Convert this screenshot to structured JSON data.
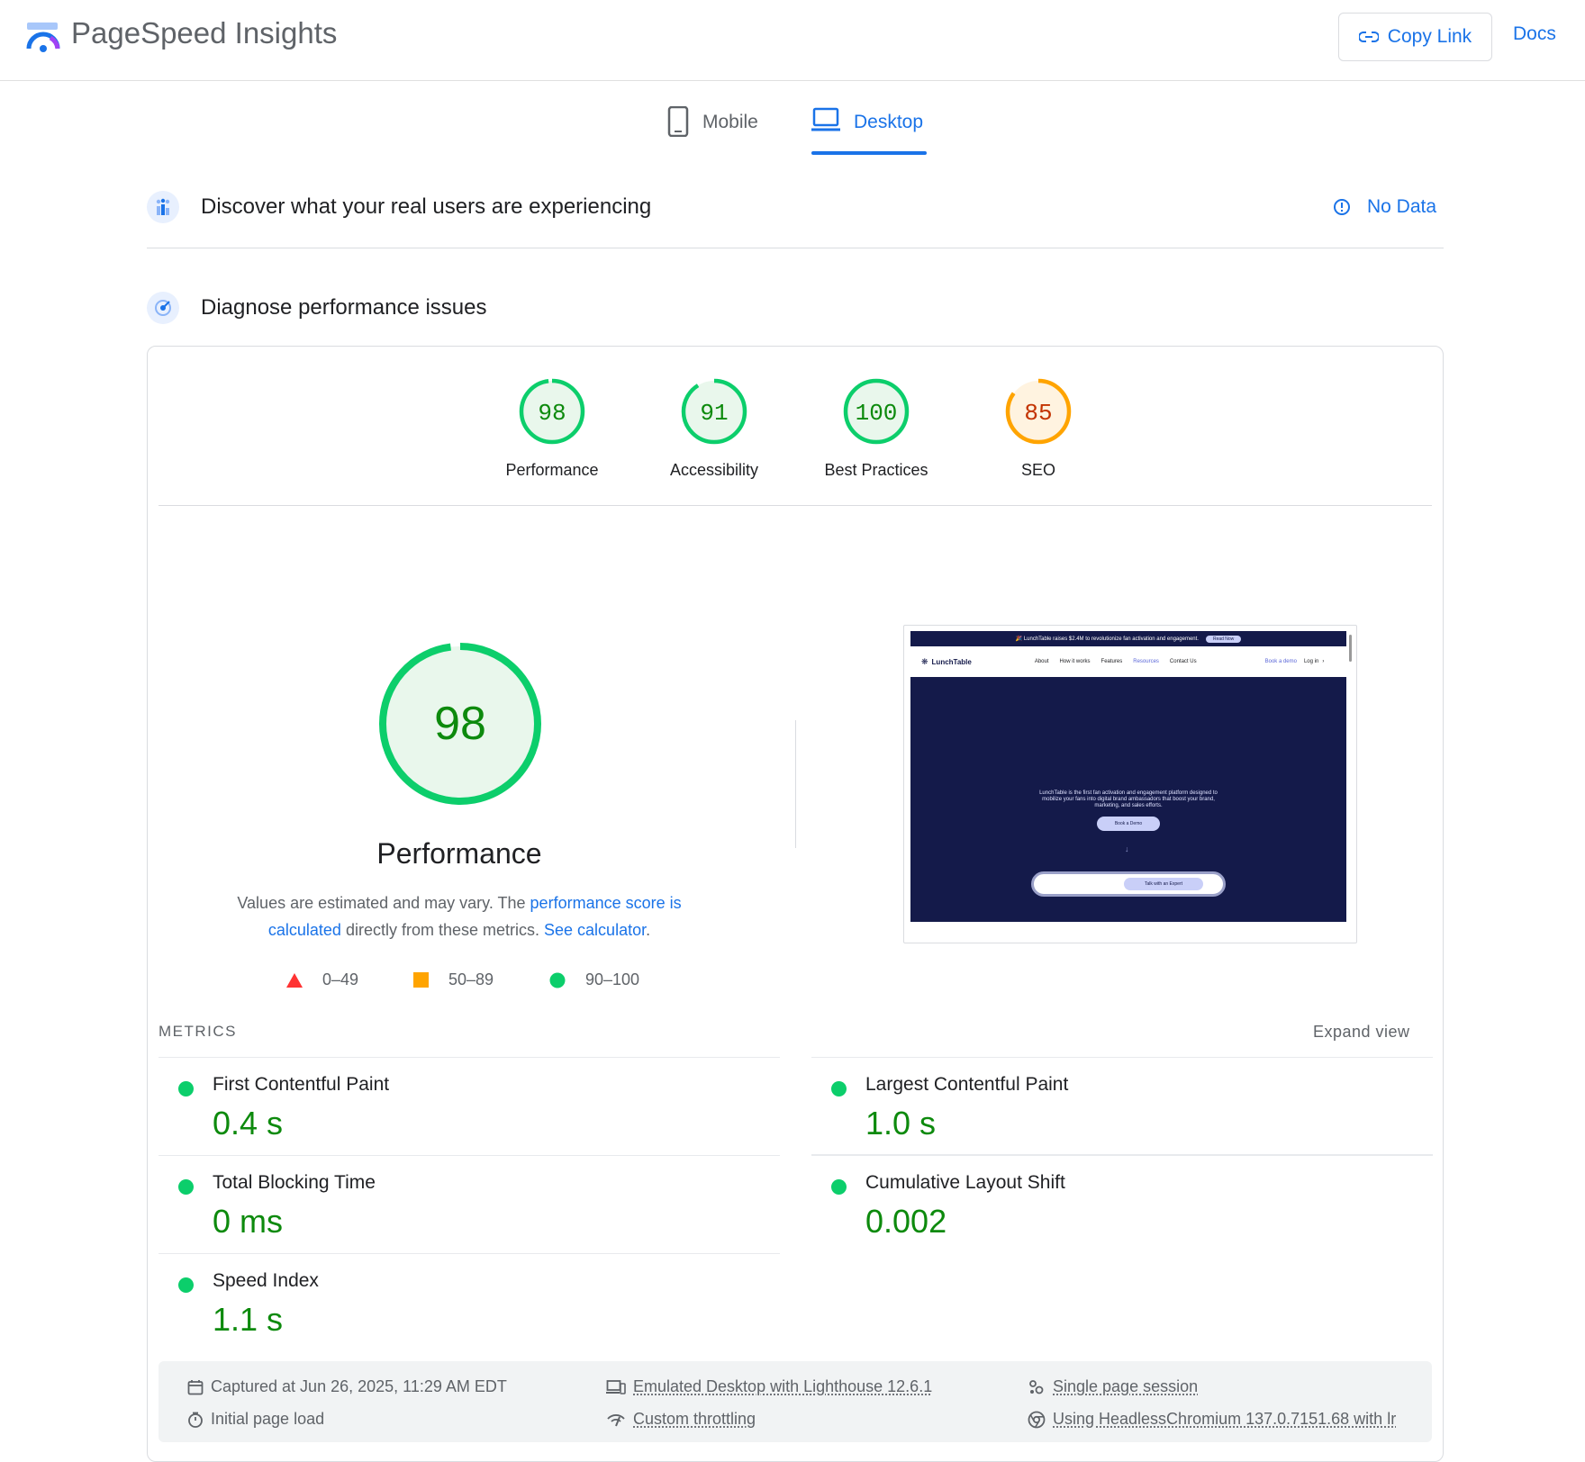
{
  "header": {
    "title": "PageSpeed Insights",
    "copy_link": "Copy Link",
    "docs": "Docs"
  },
  "tabs": [
    {
      "label": "Mobile",
      "active": false
    },
    {
      "label": "Desktop",
      "active": true
    }
  ],
  "field_data": {
    "title": "Discover what your real users are experiencing",
    "status": "No Data"
  },
  "diagnose": {
    "title": "Diagnose performance issues"
  },
  "scores": [
    {
      "label": "Performance",
      "value": "98",
      "status": "pass"
    },
    {
      "label": "Accessibility",
      "value": "91",
      "status": "pass"
    },
    {
      "label": "Best Practices",
      "value": "100",
      "status": "pass"
    },
    {
      "label": "SEO",
      "value": "85",
      "status": "average"
    }
  ],
  "performance": {
    "score": "98",
    "score_fraction": 0.98,
    "label": "Performance",
    "note_prefix": "Values are estimated and may vary. The ",
    "note_link1": "performance score is calculated",
    "note_middle": " directly from these metrics. ",
    "note_link2": "See calculator",
    "note_suffix": "."
  },
  "legend": [
    {
      "range": "0–49",
      "shape": "triangle",
      "color": "#ff3333"
    },
    {
      "range": "50–89",
      "shape": "square",
      "color": "#ffa400"
    },
    {
      "range": "90–100",
      "shape": "circle",
      "color": "#0cce6b"
    }
  ],
  "metrics_header": "METRICS",
  "expand_view": "Expand view",
  "metrics": [
    {
      "label": "First Contentful Paint",
      "value": "0.4 s"
    },
    {
      "label": "Largest Contentful Paint",
      "value": "1.0 s"
    },
    {
      "label": "Total Blocking Time",
      "value": "0 ms"
    },
    {
      "label": "Cumulative Layout Shift",
      "value": "0.002"
    },
    {
      "label": "Speed Index",
      "value": "1.1 s"
    }
  ],
  "footer": {
    "captured": "Captured at Jun 26, 2025, 11:29 AM EDT",
    "load": "Initial page load",
    "device": "Emulated Desktop with Lighthouse 12.6.1",
    "throttling": "Custom throttling",
    "session": "Single page session",
    "browser": "Using HeadlessChromium 137.0.7151.68 with lr"
  },
  "thumbnail": {
    "banner": "🎉 LunchTable raises $2.4M to revolutionize fan activation and engagement.",
    "banner_btn": "Read Now",
    "brand": "LunchTable",
    "nav": [
      "About",
      "How it works",
      "Features",
      "Resources",
      "Contact Us"
    ],
    "nav_right": [
      "Book a demo",
      "Log in"
    ],
    "hero_text": "LunchTable is the first fan activation and engagement platform designed to mobilize your fans into digital brand ambassadors that boost your brand, marketing, and sales efforts.",
    "hero_btn": "Book a Demo",
    "cta": "Talk with an Expert"
  },
  "colors": {
    "accent": "#1a73e8",
    "pass": "#0cce6b",
    "pass_text": "#0d8a0d",
    "average": "#ffa400",
    "average_text": "#c33300"
  }
}
